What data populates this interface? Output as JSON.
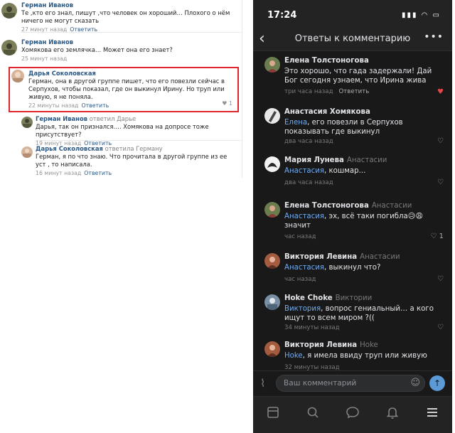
{
  "left_panel": {
    "comments": [
      {
        "author": "Герман Иванов",
        "text": "Те ,кто его знал, пишут ,что человек он хороший… Плохого о нём ничего не могут сказать",
        "time": "27 минут назад",
        "reply_label": "Ответить"
      },
      {
        "author": "Герман Иванов",
        "text": "Хомякова его землячка… Может она его знает?",
        "time": "25 минут назад"
      },
      {
        "author": "Дарья Соколовская",
        "text": "Герман, она в другой группе пишет, что его повезли сейчас в Серпухов, чтобы показал, где он выкинул Ирину. Но труп или живую, я не поняла.",
        "time": "22 минуты назад",
        "reply_label": "Ответить"
      },
      {
        "author": "Герман Иванов",
        "replied_to": "ответил Дарье",
        "text": "Дарья, так он признался…. Хомякова на допросе тоже присутствует?",
        "time": "19 минут назад",
        "reply_label": "Ответить"
      },
      {
        "author": "Дарья Соколовская",
        "replied_to": "ответила Герману",
        "text": "Герман, я по что знаю. Что прочитала в другой группе из ее уст , то написала.",
        "time": "16 минут назад",
        "reply_label": "Ответить"
      }
    ]
  },
  "phone": {
    "status_time": "17:24",
    "nav_title": "Ответы к комментарию",
    "comments": [
      {
        "author": "Елена Толстоногова",
        "to": "",
        "mention": "",
        "text": "Это хорошо, что гада задержали! Дай Бог сегодня узнаем, что Ирина жива",
        "time": "три часа назад",
        "reply_label": "Ответить",
        "likes": ""
      },
      {
        "author": "Анастасия Хомякова",
        "to": "",
        "mention": "Елена",
        "text": ", его повезли в Серпухов показывать где выкинул",
        "time": "два часа назад",
        "likes": ""
      },
      {
        "author": "Мария Лунева",
        "to": "Анастасии",
        "mention": "Анастасия",
        "text": ", кошмар...",
        "time": "два часа назад",
        "likes": ""
      },
      {
        "author": "Елена Толстоногова",
        "to": "Анастасии",
        "mention": "Анастасия",
        "text": ", эх, всё таки погибла😥😩 значит",
        "time": "час назад",
        "likes": "1"
      },
      {
        "author": "Виктория Левина",
        "to": "Анастасии",
        "mention": "Анастасия",
        "text": ", выкинул что?",
        "time": "час назад",
        "likes": ""
      },
      {
        "author": "Hoke Choke",
        "to": "Виктории",
        "mention": "Виктория",
        "text": ", вопрос гениальный… а кого ищут то всем миром ?((",
        "time": "34 минуты назад",
        "likes": ""
      },
      {
        "author": "Виктория Левина",
        "to": "Hoke",
        "mention": "Hoke",
        "text": ", я имела ввиду труп или живую",
        "time": "32 минуты назад",
        "likes": ""
      }
    ],
    "composer_placeholder": "Ваш комментарий",
    "colors": {
      "accent": "#71aaeb",
      "background": "#19191a",
      "like_red": "#e64646",
      "highlight": "#e0262b"
    },
    "tabbar_icons": [
      "news-icon",
      "search-icon",
      "messages-icon",
      "notifications-icon",
      "menu-icon"
    ]
  }
}
